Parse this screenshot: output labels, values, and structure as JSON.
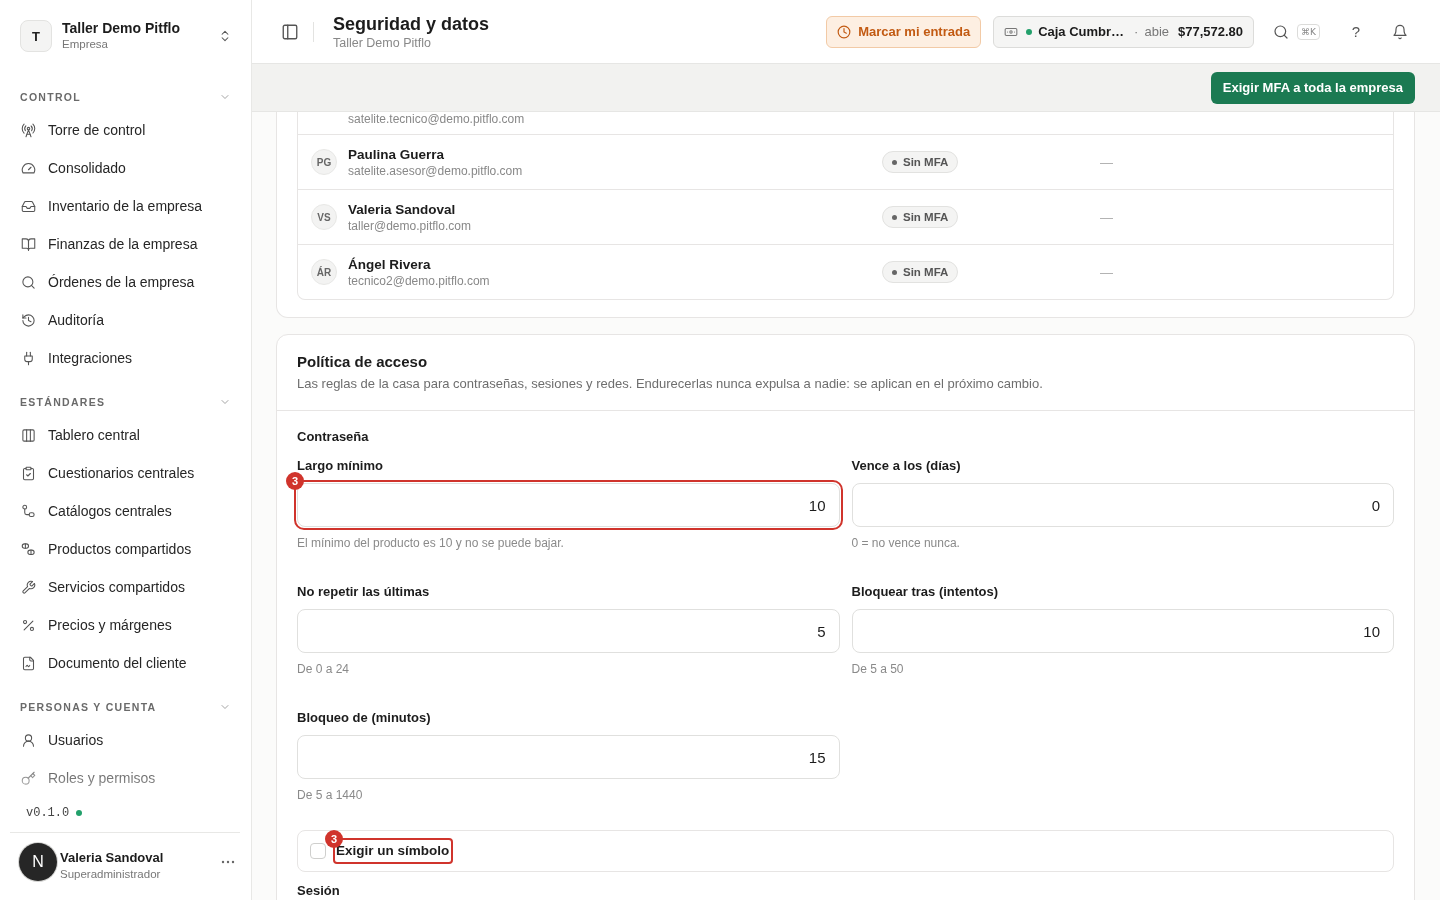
{
  "sidebar": {
    "workspace": {
      "initial": "T",
      "name": "Taller Demo Pitflo",
      "subtitle": "Empresa"
    },
    "sections": [
      {
        "title": "CONTROL",
        "expanded": true,
        "items": [
          {
            "label": "Torre de control",
            "selected": false
          },
          {
            "label": "Consolidado",
            "selected": false
          },
          {
            "label": "Inventario de la empresa",
            "selected": false
          },
          {
            "label": "Finanzas de la empresa",
            "selected": false
          },
          {
            "label": "Órdenes de la empresa",
            "selected": false
          },
          {
            "label": "Auditoría",
            "selected": false
          },
          {
            "label": "Integraciones",
            "selected": false
          }
        ]
      },
      {
        "title": "ESTÁNDARES",
        "expanded": true,
        "items": [
          {
            "label": "Tablero central",
            "selected": false
          },
          {
            "label": "Cuestionarios centrales",
            "selected": false
          },
          {
            "label": "Catálogos centrales",
            "selected": false
          },
          {
            "label": "Productos compartidos",
            "selected": false
          },
          {
            "label": "Servicios compartidos",
            "selected": false
          },
          {
            "label": "Precios y márgenes",
            "selected": false
          },
          {
            "label": "Documento del cliente",
            "selected": false
          }
        ]
      },
      {
        "title": "PERSONAS Y CUENTA",
        "expanded": true,
        "items": [
          {
            "label": "Usuarios",
            "selected": false
          },
          {
            "label": "Roles y permisos",
            "selected": false
          }
        ]
      }
    ],
    "version": "v0.1.0",
    "user": {
      "initial": "N",
      "name": "Valeria Sandoval",
      "role": "Superadministrador"
    }
  },
  "header": {
    "title": "Seguridad y datos",
    "subtitle": "Taller Demo Pitflo",
    "clock_in_button": "Marcar mi entrada",
    "cash_register": {
      "name": "Caja Cumbr…",
      "separator": "·",
      "status": "abie",
      "amount": "$77,572.80"
    },
    "shortcut": "⌘K",
    "help": "?"
  },
  "toolbar": {
    "action_button": "Exigir MFA a toda la empresa"
  },
  "members_table": {
    "rows": [
      {
        "email": "satelite.tecnico@demo.pitflo.com"
      },
      {
        "initials": "PG",
        "name": "Paulina Guerra",
        "email": "satelite.asesor@demo.pitflo.com",
        "mfa_badge": "Sin MFA",
        "column_3": "—"
      },
      {
        "initials": "VS",
        "name": "Valeria Sandoval",
        "email": "taller@demo.pitflo.com",
        "mfa_badge": "Sin MFA",
        "column_3": "—"
      },
      {
        "initials": "ÁR",
        "name": "Ángel Rivera",
        "email": "tecnico2@demo.pitflo.com",
        "mfa_badge": "Sin MFA",
        "column_3": "—"
      }
    ]
  },
  "access_policy": {
    "title": "Política de acceso",
    "description": "Las reglas de la casa para contraseñas, sesiones y redes. Endurecerlas nunca expulsa a nadie: se aplican en el próximo cambio.",
    "groups": [
      {
        "title": "Contraseña",
        "fields": [
          {
            "label": "Largo mínimo",
            "value": "10",
            "hint": "El mínimo del producto es 10 y no se puede bajar.",
            "marker": "3"
          },
          {
            "label": "Vence a los (días)",
            "value": "0",
            "hint": "0 = no vence nunca."
          },
          {
            "label": "No repetir las últimas",
            "value": "5",
            "hint": "De 0 a 24"
          },
          {
            "label": "Bloquear tras (intentos)",
            "value": "10",
            "hint": "De 5 a 50"
          },
          {
            "label": "Bloqueo de (minutos)",
            "value": "15",
            "hint": "De 5 a 1440"
          }
        ],
        "checkbox": {
          "label": "Exigir un símbolo",
          "checked": false,
          "marker": "3"
        }
      },
      {
        "title": "Sesión"
      }
    ]
  }
}
